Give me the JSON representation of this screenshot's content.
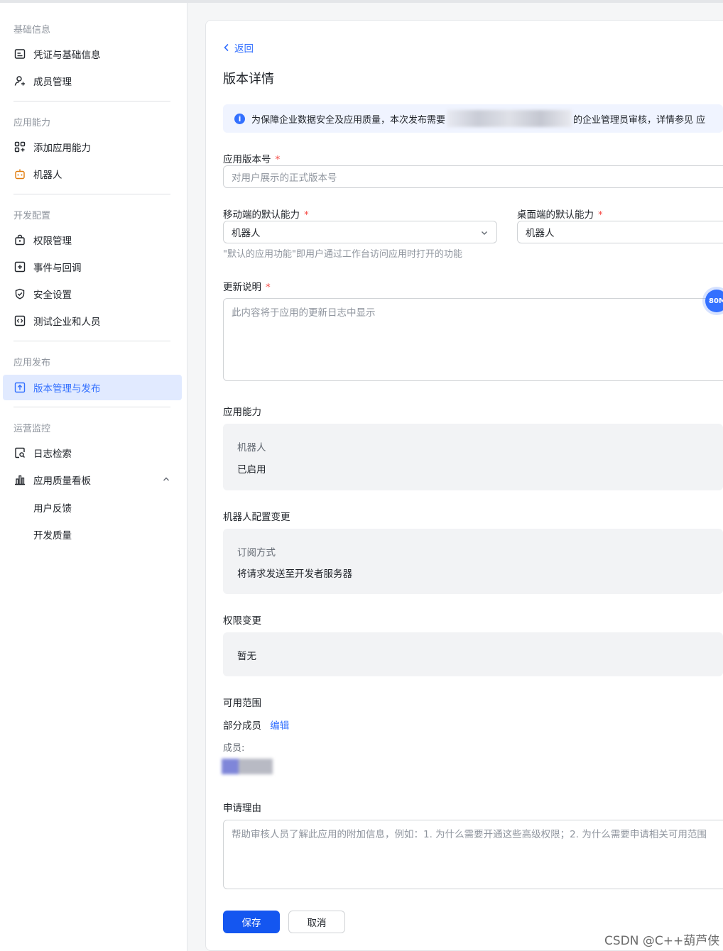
{
  "sidebar": {
    "groups": [
      {
        "title": "基础信息"
      },
      {
        "title": "应用能力"
      },
      {
        "title": "开发配置"
      },
      {
        "title": "应用发布"
      },
      {
        "title": "运营监控"
      }
    ],
    "items": [
      {
        "label": "凭证与基础信息",
        "icon": "credential-card-icon"
      },
      {
        "label": "成员管理",
        "icon": "user-add-icon"
      },
      {
        "label": "添加应用能力",
        "icon": "grid-plus-icon"
      },
      {
        "label": "机器人",
        "icon": "robot-icon"
      },
      {
        "label": "权限管理",
        "icon": "lock-icon"
      },
      {
        "label": "事件与回调",
        "icon": "event-plus-icon"
      },
      {
        "label": "安全设置",
        "icon": "shield-check-icon"
      },
      {
        "label": "测试企业和人员",
        "icon": "code-box-icon"
      },
      {
        "label": "版本管理与发布",
        "icon": "upload-box-icon",
        "active": true
      },
      {
        "label": "日志检索",
        "icon": "search-doc-icon"
      },
      {
        "label": "应用质量看板",
        "icon": "bar-chart-icon"
      }
    ],
    "sub_items": [
      {
        "label": "用户反馈"
      },
      {
        "label": "开发质量"
      }
    ]
  },
  "main": {
    "back_label": "返回",
    "title": "版本详情",
    "notice": {
      "text_before": "为保障企业数据安全及应用质量，本次发布需要",
      "text_after": "的企业管理员审核，详情参见 应"
    },
    "version": {
      "label": "应用版本号",
      "placeholder": "对用户展示的正式版本号"
    },
    "mobile_default": {
      "label": "移动端的默认能力",
      "value": "机器人"
    },
    "desktop_default": {
      "label": "桌面端的默认能力",
      "value": "机器人"
    },
    "default_hint": "\"默认的应用功能\"即用户通过工作台访问应用时打开的功能",
    "update_notes": {
      "label": "更新说明",
      "placeholder": "此内容将于应用的更新日志中显示"
    },
    "float_badge": "80M",
    "capabilities": {
      "title": "应用能力",
      "key": "机器人",
      "value": "已启用"
    },
    "bot_config": {
      "title": "机器人配置变更",
      "key": "订阅方式",
      "value": "将请求发送至开发者服务器"
    },
    "permissions": {
      "title": "权限变更",
      "value": "暂无"
    },
    "scope": {
      "title": "可用范围",
      "value": "部分成员",
      "edit_label": "编辑",
      "members_label": "成员:"
    },
    "reason": {
      "label": "申请理由",
      "placeholder": "帮助审核人员了解此应用的附加信息，例如：1. 为什么需要开通这些高级权限；2. 为什么需要申请相关可用范围"
    },
    "save_label": "保存",
    "cancel_label": "取消"
  },
  "watermark": "CSDN @C++葫芦侠",
  "colors": {
    "accent": "#3370ff",
    "primary_button": "#1456f0",
    "required": "#f54a45",
    "active_bg": "#e1eaff"
  }
}
